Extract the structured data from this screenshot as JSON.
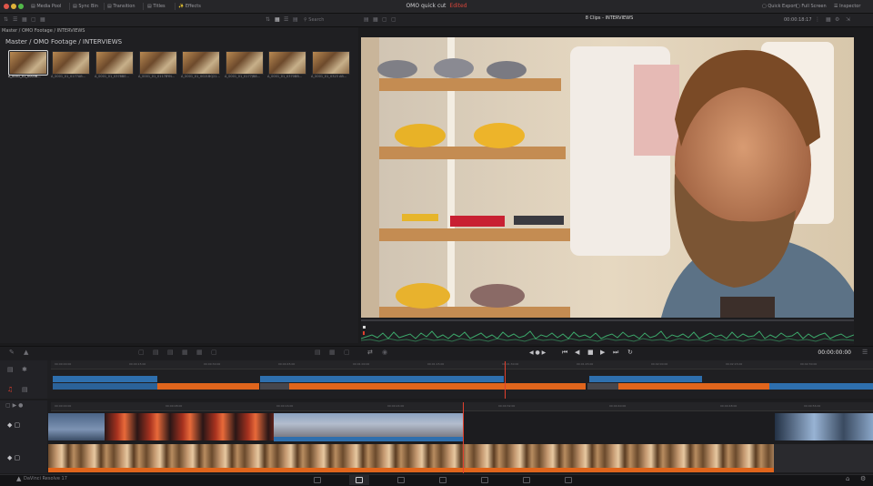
{
  "toolbar": {
    "media_pool": "Media Pool",
    "sync_bin": "Sync Bin",
    "transitions": "Transition",
    "titles": "Titles",
    "effects": "Effects",
    "quick_export": "Quick Export",
    "full_screen": "Full Screen",
    "inspector": "Inspector"
  },
  "project": {
    "name": "OMO quick cut",
    "status": "Edited"
  },
  "pool": {
    "breadcrumb": "Master / OMO Footage / INTERVIEWS",
    "path": "Master / OMO Footage / INTERVIEWS",
    "search_label": "Search",
    "clips": [
      "A_0001_01_0003B...",
      "A_0001_01_0177AB...",
      "A_0001_01_0378BE...",
      "A_0001_01_0117BYN...",
      "A_0001_01_0021BQ21...",
      "A_0001_01_0177JB8...",
      "A_0001_01_0370BB...",
      "A_0001_01_0323 AB..."
    ]
  },
  "viewer": {
    "clip_title": "8 Clips - INTERVIEWS",
    "zoom": "00:00:18:17"
  },
  "transport": {
    "timecode": "00:00:00:00"
  },
  "ruler_upper": [
    "00:00:00:00",
    "00:00:15:00",
    "00:00:30:00",
    "00:00:45:00",
    "00:01:00:00",
    "00:01:15:00",
    "00:01:30:00",
    "00:01:45:00",
    "00:02:00:00",
    "00:02:15:00",
    "00:02:30:00"
  ],
  "ruler_lower": [
    "00:00:00:00",
    "00:00:08:00",
    "00:00:16:00",
    "00:00:24:00",
    "00:00:32:00",
    "00:00:40:00",
    "00:00:48:00",
    "00:00:56:00"
  ],
  "footer": {
    "app_name": "DaVinci Resolve 17",
    "pages": [
      "Media",
      "Cut",
      "Edit",
      "Fusion",
      "Color",
      "Fairlight",
      "Deliver"
    ],
    "active_page": "Cut"
  },
  "colors": {
    "accent_red": "#e2402e",
    "video_blue": "#2e6fae",
    "audio_orange": "#e0651c",
    "audio_green": "#3ca86a"
  }
}
